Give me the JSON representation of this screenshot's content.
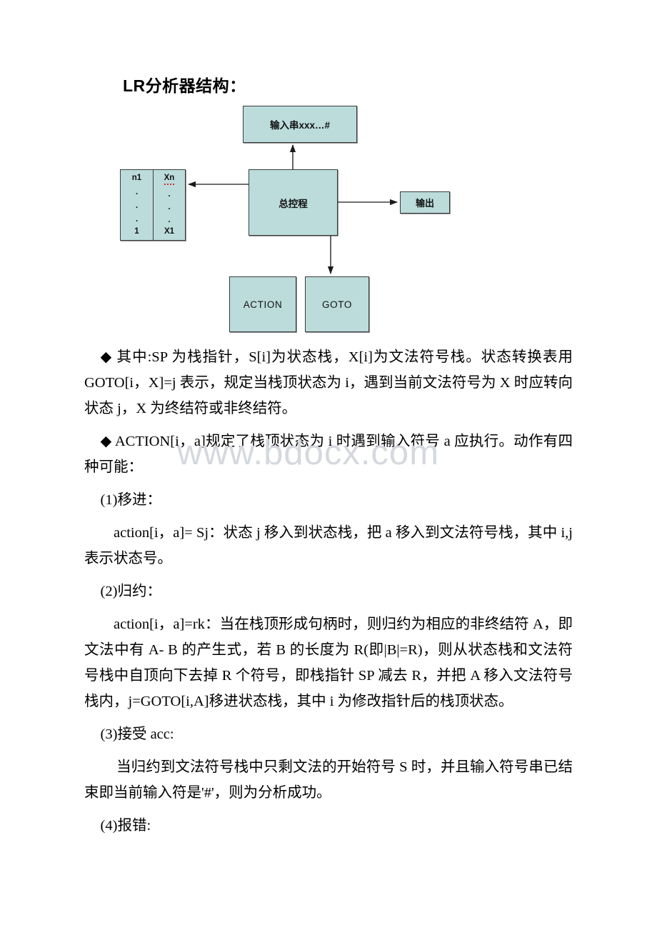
{
  "document": {
    "title": "LR分析器结构："
  },
  "diagram": {
    "nodes": {
      "input_string": "输入串xxx…#",
      "controller": "总控程",
      "output": "输出",
      "action_table": "ACTION",
      "goto_table": "GOTO"
    },
    "stack": {
      "state_column": [
        "n1",
        ".",
        ".",
        ".",
        "1"
      ],
      "symbol_column": [
        "Xn",
        ".",
        ".",
        ".",
        "X1"
      ],
      "misspelled_cell": "Xn"
    },
    "box_fill_color": "#bcdcdc",
    "box_border_color": "#3a3a3a"
  },
  "watermark": {
    "text": "www.bdocx.com",
    "color": "#d5d8de"
  },
  "body": {
    "bullet_glyph": "◆",
    "paragraphs": [
      {
        "id": "p-goto-desc",
        "text": "◆ 其中:SP 为栈指针，S[i]为状态栈，X[i]为文法符号栈。状态转换表用 GOTO[i，X]=j 表示，规定当栈顶状态为 i，遇到当前文法符号为 X 时应转向状态 j，X 为终结符或非终结符。"
      },
      {
        "id": "p-action-desc",
        "text": "◆ ACTION[i，a]规定了栈顶状态为 i 时遇到输入符号 a 应执行。动作有四种可能："
      },
      {
        "id": "p-item1-head",
        "text": "(1)移进："
      },
      {
        "id": "p-item1-body",
        "text": "action[i，a]= Sj：状态 j 移入到状态栈，把 a 移入到文法符号栈，其中 i,j 表示状态号。"
      },
      {
        "id": "p-item2-head",
        "text": "(2)归约："
      },
      {
        "id": "p-item2-body",
        "text": "action[i，a]=rk：当在栈顶形成句柄时，则归约为相应的非终结符 A，即文法中有 A- B 的产生式，若 B 的长度为 R(即|B|=R)，则从状态栈和文法符号栈中自顶向下去掉 R 个符号，即栈指针 SP 减去 R，并把 A 移入文法符号栈内，j=GOTO[i,A]移进状态栈，其中 i 为修改指针后的栈顶状态。"
      },
      {
        "id": "p-item3-head",
        "text": "(3)接受 acc:"
      },
      {
        "id": "p-item3-body",
        "text": "当归约到文法符号栈中只剩文法的开始符号 S 时，并且输入符号串已结束即当前输入符是'#'，则为分析成功。"
      },
      {
        "id": "p-item4-head",
        "text": "(4)报错:"
      }
    ]
  }
}
